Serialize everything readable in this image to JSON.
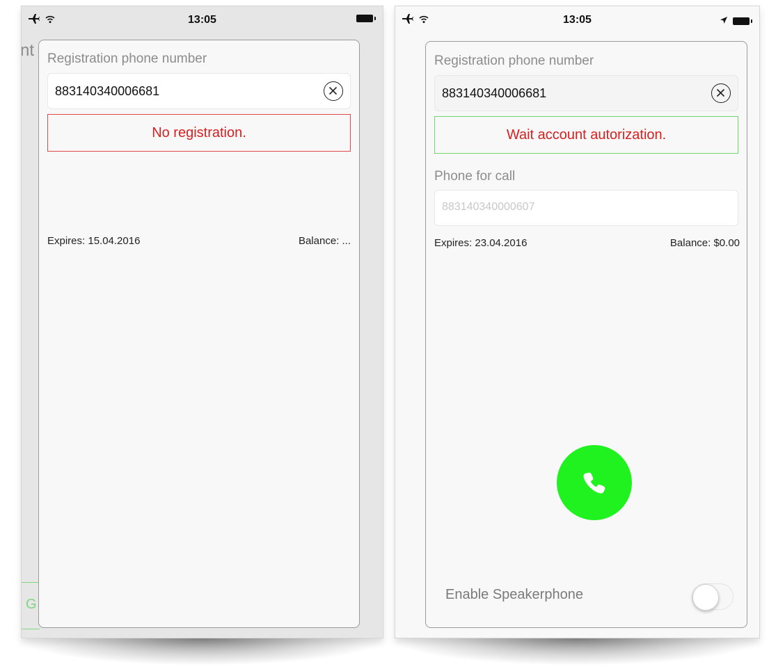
{
  "left": {
    "status_time": "13:05",
    "behind_title_fragment": "nt",
    "behind_button_fragment": "G",
    "registration_label": "Registration phone number",
    "registration_value": "883140340006681",
    "status_message": "No registration.",
    "expires": "Expires: 15.04.2016",
    "balance": "Balance: ..."
  },
  "right": {
    "status_time": "13:05",
    "registration_label": "Registration phone number",
    "registration_value": "883140340006681",
    "status_message": "Wait account autorization.",
    "phone_label": "Phone for call",
    "phone_placeholder": "883140340000607",
    "expires": "Expires: 23.04.2016",
    "balance": "Balance: $0.00",
    "speaker_label": "Enable Speakerphone",
    "speaker_enabled": false
  },
  "colors": {
    "error_text": "#d81f1f",
    "error_border": "#e14a4a",
    "ok_border": "#6ed86e",
    "call_button": "#1ff21f"
  }
}
